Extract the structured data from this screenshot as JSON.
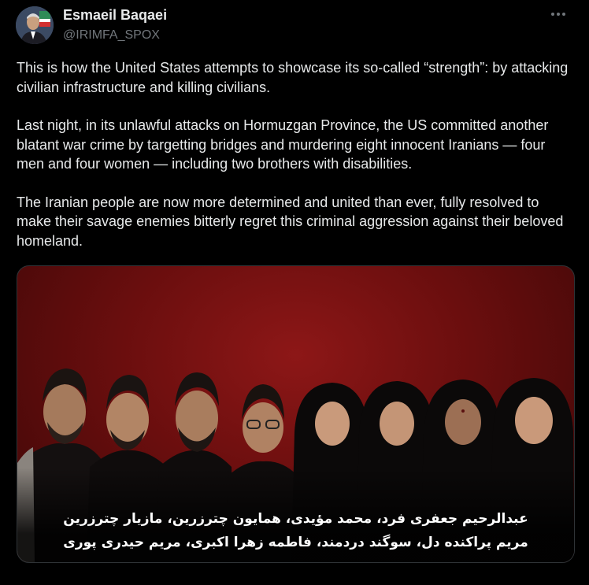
{
  "author": {
    "name": "Esmaeil Baqaei",
    "handle": "@IRIMFA_SPOX"
  },
  "tweet": {
    "paragraphs": [
      "This is how the United States attempts to showcase its so-called “strength”: by attacking civilian infrastructure and killing civilians.",
      "Last night, in its unlawful attacks on Hormuzgan Province, the US committed another blatant war crime by targetting bridges and murdering eight innocent Iranians — four men and four women — including two brothers with disabilities.",
      "The Iranian people are now more determined and united than ever, fully resolved to make their savage enemies bitterly regret this criminal aggression against their beloved homeland."
    ]
  },
  "media": {
    "caption_line1": "عبدالرحیم جعفری فرد، محمد مؤیدی، همایون چترزرین، مازیار چترزرین",
    "caption_line2": "مریم پراکنده دل، سوگند دردمند، فاطمه زهرا اکبری، مریم حیدری پوری"
  },
  "colors": {
    "background": "#000000",
    "text": "#e7e9ea",
    "secondary": "#71767b",
    "media_red": "#8d1717"
  },
  "icons": {
    "more": "more-horizontal-icon"
  }
}
